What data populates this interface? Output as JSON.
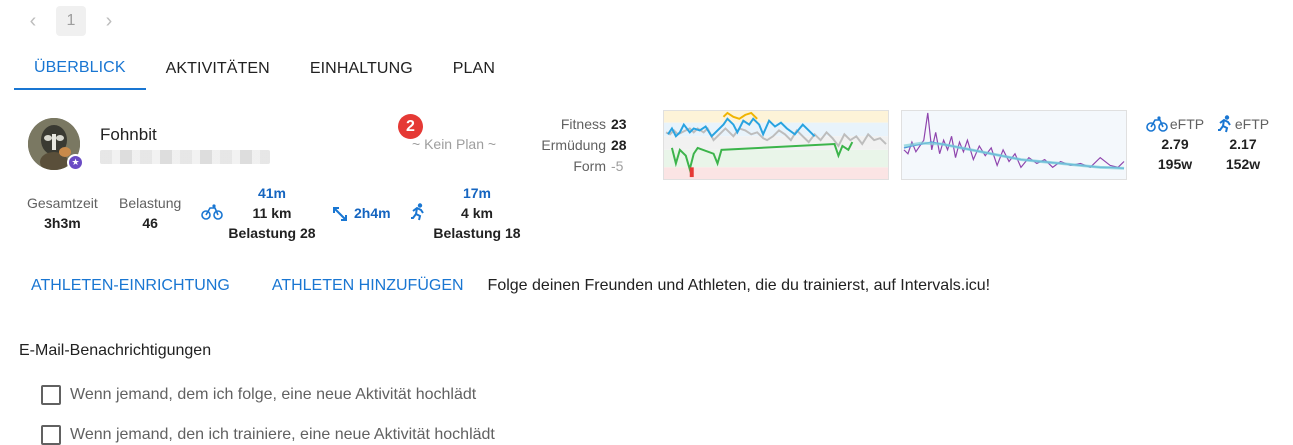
{
  "pager": {
    "prev": "‹",
    "page": "1",
    "next": "›"
  },
  "tabs": [
    {
      "label": "ÜBERBLICK",
      "active": true
    },
    {
      "label": "AKTIVITÄTEN",
      "active": false
    },
    {
      "label": "EINHALTUNG",
      "active": false
    },
    {
      "label": "PLAN",
      "active": false
    }
  ],
  "athlete": {
    "name": "Fohnbit",
    "notification_count": "2",
    "plan_status": "~ Kein Plan ~"
  },
  "fitness": {
    "fitness_label": "Fitness",
    "fitness_value": "23",
    "fatigue_label": "Ermüdung",
    "fatigue_value": "28",
    "form_label": "Form",
    "form_value": "-5"
  },
  "eftp": {
    "ride": {
      "label": "eFTP",
      "wkg": "2.79",
      "watts": "195w"
    },
    "run": {
      "label": "eFTP",
      "wkg": "2.17",
      "watts": "152w"
    }
  },
  "stats": {
    "total_time_label": "Gesamtzeit",
    "total_time": "3h3m",
    "load_label": "Belastung",
    "load": "46",
    "ride_time": "41m",
    "ride_distance": "11 km",
    "ride_load": "Belastung 28",
    "other_time": "2h4m",
    "run_time": "17m",
    "run_distance": "4 km",
    "run_load": "Belastung 18"
  },
  "links": {
    "setup": "ATHLETEN-EINRICHTUNG",
    "add": "ATHLETEN HINZUFÜGEN",
    "follow_text": "Folge deinen Freunden und Athleten, die du trainierst, auf Intervals.icu!"
  },
  "email": {
    "title": "E-Mail-Benachrichtigungen",
    "options": [
      {
        "label": "Wenn jemand, dem ich folge, eine neue Aktivität hochlädt",
        "checked": false
      },
      {
        "label": "Wenn jemand, den ich trainiere, eine neue Aktivität hochlädt",
        "checked": false
      }
    ]
  },
  "colors": {
    "accent": "#1976d2",
    "badge": "#e53935",
    "star_badge": "#6a4bc4"
  },
  "icons": {
    "ride": "bike-icon",
    "run": "run-icon",
    "other": "expand-arrows-icon",
    "star": "star-icon"
  }
}
